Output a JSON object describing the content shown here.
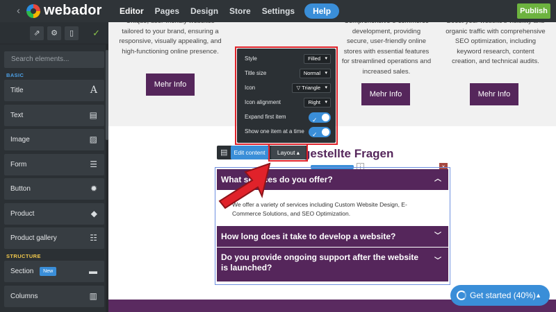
{
  "app": {
    "logo_text": "webador",
    "back_icon": "chevron-left-icon",
    "nav": [
      {
        "label": "Editor",
        "active": true
      },
      {
        "label": "Pages",
        "active": false
      },
      {
        "label": "Design",
        "active": false
      },
      {
        "label": "Store",
        "active": false
      },
      {
        "label": "Settings",
        "active": false
      }
    ],
    "help_label": "Help",
    "publish_label": "Publish"
  },
  "sidebar": {
    "search_placeholder": "Search elements...",
    "basic_label": "BASIC",
    "basic_items": [
      {
        "label": "Title",
        "icon": "A"
      },
      {
        "label": "Text",
        "icon": "▤"
      },
      {
        "label": "Image",
        "icon": "▨"
      },
      {
        "label": "Form",
        "icon": "☰"
      },
      {
        "label": "Button",
        "icon": "✹"
      },
      {
        "label": "Product",
        "icon": "◆"
      },
      {
        "label": "Product gallery",
        "icon": "☷"
      }
    ],
    "structure_label": "STRUCTURE",
    "structure_items": [
      {
        "label": "Section",
        "badge": "New",
        "icon": "▬"
      },
      {
        "label": "Columns",
        "icon": "▥"
      }
    ]
  },
  "canvas": {
    "columns": [
      {
        "text": "Unique, user-friendly websites tailored to your brand, ensuring a responsive, visually appealing, and high-functioning online presence.",
        "button": "Mehr Info"
      },
      {
        "text": "Comprehensive e-commerce development, providing secure, user-friendly online stores with essential features for streamlined operations and increased sales.",
        "button": "Mehr Info"
      },
      {
        "text": "Boost your website's visibility and organic traffic with comprehensive SEO optimization, including keyword research, content creation, and technical audits.",
        "button": "Mehr Info"
      }
    ],
    "faq_title": "gestellte Fragen",
    "faq": [
      {
        "question": "What services do you offer?",
        "answer": "We offer a variety of services including Custom Website Design, E-Commerce Solutions, and SEO Optimization.",
        "open": true
      },
      {
        "question": "How long does it take to develop a website?",
        "open": false
      },
      {
        "question": "Do you provide ongoing support after the website is launched?",
        "open": false
      }
    ]
  },
  "toolbar": {
    "edit_content": "Edit content",
    "layout": "Layout ▴"
  },
  "layout_popover": {
    "style": {
      "label": "Style",
      "value": "Filled"
    },
    "title_size": {
      "label": "Title size",
      "value": "Normal"
    },
    "icon": {
      "label": "Icon",
      "value": "▽ Triangle"
    },
    "icon_alignment": {
      "label": "Icon alignment",
      "value": "Right"
    },
    "expand_first": {
      "label": "Expand first item",
      "on": true
    },
    "show_one": {
      "label": "Show one item at a time",
      "on": true
    }
  },
  "get_started": "Get started (40%)",
  "colors": {
    "accent": "#3a8ed8",
    "brand_purple": "#55265b",
    "publish_green": "#6db33f",
    "highlight_red": "#e0222a"
  }
}
